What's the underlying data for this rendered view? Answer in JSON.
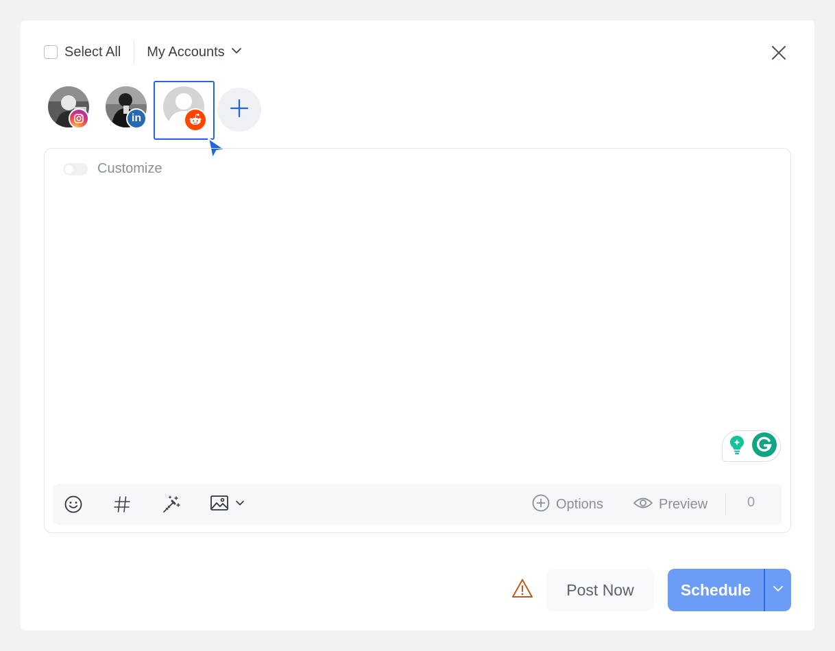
{
  "header": {
    "select_all_label": "Select All",
    "accounts_dropdown_label": "My Accounts"
  },
  "accounts": [
    {
      "network": "instagram-icon",
      "selected": false
    },
    {
      "network": "linkedin-icon",
      "selected": false
    },
    {
      "network": "reddit-icon",
      "selected": true
    }
  ],
  "composer": {
    "customize_label": "Customize",
    "text": ""
  },
  "toolbar": {
    "options_label": "Options",
    "preview_label": "Preview",
    "char_count": "0"
  },
  "footer": {
    "post_now_label": "Post Now",
    "schedule_label": "Schedule"
  },
  "colors": {
    "accent": "#1f63e6",
    "schedule_bg": "#6b9cf6",
    "warning": "#c2571a",
    "reddit": "#ff4500",
    "linkedin": "#2867b2",
    "grammarly": "#15c39a"
  }
}
